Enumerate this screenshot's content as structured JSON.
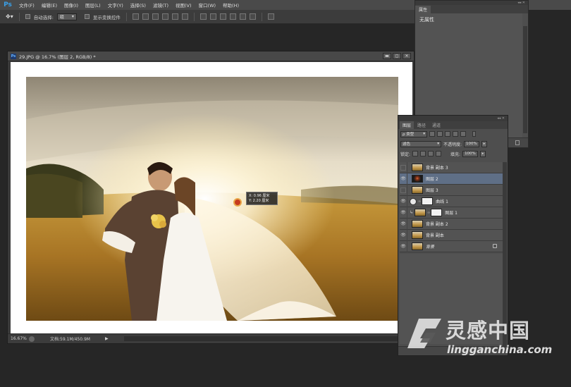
{
  "app": {
    "logo": "Ps",
    "menu": [
      "文件(F)",
      "编辑(E)",
      "图像(I)",
      "图层(L)",
      "文字(Y)",
      "选择(S)",
      "滤镜(T)",
      "视图(V)",
      "窗口(W)",
      "帮助(H)"
    ]
  },
  "options_bar": {
    "auto_select_label": "自动选择:",
    "auto_select_value": "组",
    "show_transform_label": "显示变换控件"
  },
  "properties": {
    "tab": "属性",
    "content": "无属性"
  },
  "document": {
    "title": "29.JPG @ 16.7% (图层 2, RGB/8) *",
    "zoom": "16.67%",
    "doc_size": "文档:59.1M/450.9M",
    "window_buttons": [
      "▬",
      "◻",
      "✕"
    ]
  },
  "measurement": {
    "x_line": "X: 0.96 厘米",
    "y_line": "Y: 2.20 厘米"
  },
  "layers_panel": {
    "tabs": [
      "图层",
      "路径",
      "通道"
    ],
    "filter_label": "ρ 类型",
    "blend_mode": "滤色",
    "opacity_label": "不透明度:",
    "opacity_value": "100%",
    "lock_label": "锁定:",
    "fill_label": "填充:",
    "fill_value": "100%",
    "layers": [
      {
        "name": "背景 副本 3",
        "visible": false,
        "type": "photo",
        "selected": false
      },
      {
        "name": "图层 2",
        "visible": true,
        "type": "dark",
        "selected": true
      },
      {
        "name": "图层 3",
        "visible": false,
        "type": "photo",
        "selected": false
      },
      {
        "name": "曲线 1",
        "visible": true,
        "type": "adjustment",
        "selected": false
      },
      {
        "name": "图层 1",
        "visible": true,
        "type": "clipped",
        "selected": false
      },
      {
        "name": "背景 副本 2",
        "visible": true,
        "type": "photo",
        "selected": false
      },
      {
        "name": "背景 副本",
        "visible": true,
        "type": "photo",
        "selected": false
      },
      {
        "name": "背景",
        "visible": true,
        "type": "background",
        "selected": false
      }
    ]
  },
  "watermark": {
    "cn": "灵感中国",
    "en": "lingganchina.com"
  },
  "colors": {
    "accent": "#3aa0e8",
    "selected_layer": "#5f6f86",
    "canvas_bg": "#ffffff",
    "app_bg": "#262626"
  }
}
